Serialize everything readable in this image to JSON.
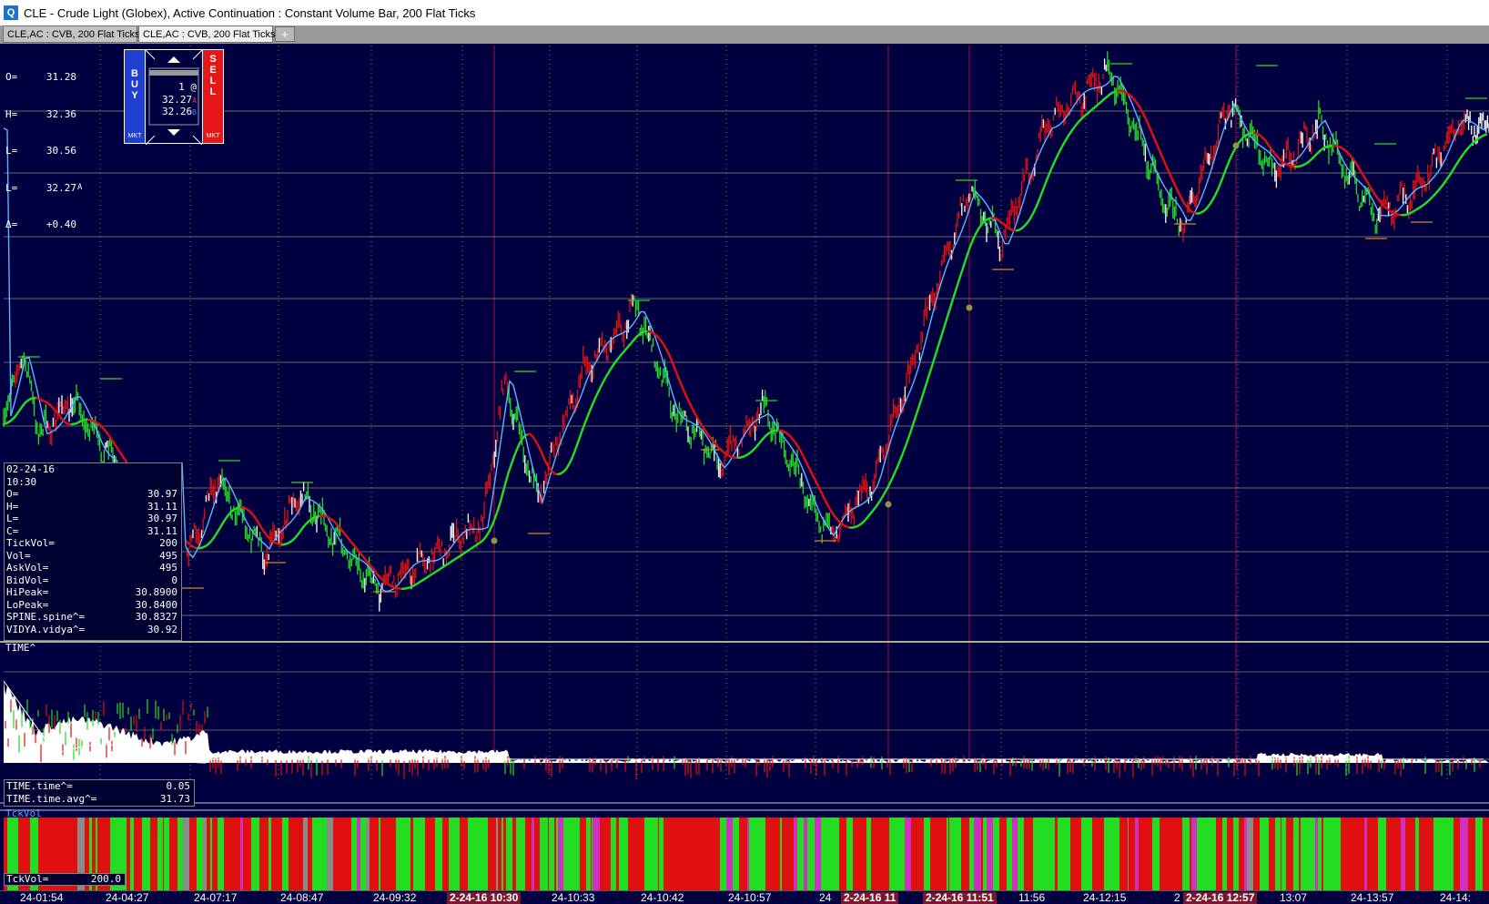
{
  "window": {
    "title": "CLE - Crude Light (Globex), Active Continuation : Constant Volume Bar, 200 Flat Ticks",
    "icon": "app-q-icon"
  },
  "tabs": [
    {
      "label": "CLE,AC : CVB, 200 Flat Ticks",
      "active": false
    },
    {
      "label": "CLE,AC : CVB, 200 Flat Ticks",
      "active": true
    },
    {
      "label": "+"
    }
  ],
  "quote": {
    "o_label": "O=",
    "o": "31.28",
    "h_label": "H=",
    "h": "32.36",
    "l_label": "L=",
    "l": "30.56",
    "last_label": "L=",
    "last": "32.27",
    "last_marker": "A",
    "delta_label": "Δ=",
    "delta": "+0.40"
  },
  "order_ticket": {
    "buy_label": "BUY",
    "sell_label": "SELL",
    "buy_sub": "MKT",
    "sell_sub": "MKT",
    "qty": "1 @",
    "ask": "32.27",
    "ask_marker": "A",
    "bid": "32.26",
    "bid_marker": "B"
  },
  "bar_info": {
    "date": "02-24-16",
    "time": "10:30",
    "rows": [
      {
        "k": "O=",
        "v": "30.97"
      },
      {
        "k": "H=",
        "v": "31.11"
      },
      {
        "k": "L=",
        "v": "30.97"
      },
      {
        "k": "C=",
        "v": "31.11"
      },
      {
        "k": "TickVol=",
        "v": "200"
      },
      {
        "k": "Vol=",
        "v": "495"
      },
      {
        "k": "AskVol=",
        "v": "495"
      },
      {
        "k": "BidVol=",
        "v": "0"
      },
      {
        "k": "HiPeak=",
        "v": "30.8900"
      },
      {
        "k": "LoPeak=",
        "v": "30.8400"
      },
      {
        "k": "SPINE.spine^=",
        "v": "30.8327"
      },
      {
        "k": "VIDYA.vidya^=",
        "v": "30.92"
      }
    ]
  },
  "time_panel": {
    "label": "TIME^",
    "rows": [
      {
        "k": "TIME.time^=",
        "v": "0.05"
      },
      {
        "k": "TIME.time.avg^=",
        "v": "31.73"
      }
    ]
  },
  "tckvol_panel": {
    "label": "TckVol",
    "row": {
      "k": "TckVol=",
      "v": "200.0"
    }
  },
  "time_axis": [
    {
      "label": "24-01:54",
      "hl": false
    },
    {
      "label": "24-04:27",
      "hl": false
    },
    {
      "label": "24-07:17",
      "hl": false
    },
    {
      "label": "24-08:47",
      "hl": false
    },
    {
      "label": "24-09:32",
      "hl": false
    },
    {
      "label": "2-24-16  10:30",
      "hl": true
    },
    {
      "label": "24-10:33",
      "hl": false
    },
    {
      "label": "24-10:42",
      "hl": false
    },
    {
      "label": "24-10:57",
      "hl": false
    },
    {
      "label": "24",
      "hl": false
    },
    {
      "label": "2-24-16  11",
      "hl": true
    },
    {
      "label": "2-24-16  11:51",
      "hl": true
    },
    {
      "label": "11:56",
      "hl": false
    },
    {
      "label": "24-12:15",
      "hl": false
    },
    {
      "label": "2",
      "hl": false
    },
    {
      "label": "2-24-16  12:57",
      "hl": true
    },
    {
      "label": "13:07",
      "hl": false
    },
    {
      "label": "24-13:57",
      "hl": false
    },
    {
      "label": "24-14:",
      "hl": false
    }
  ],
  "colors": {
    "background": "#000040",
    "up_bars": "#22dd22",
    "down_bars": "#e01010",
    "neutral_bars": "#ffffff",
    "vidya_up": "#22dd22",
    "vidya_down": "#e01010",
    "fast_avg": "#5fb4ff",
    "grid": "#b0b080",
    "session_line": "#a01040"
  }
}
